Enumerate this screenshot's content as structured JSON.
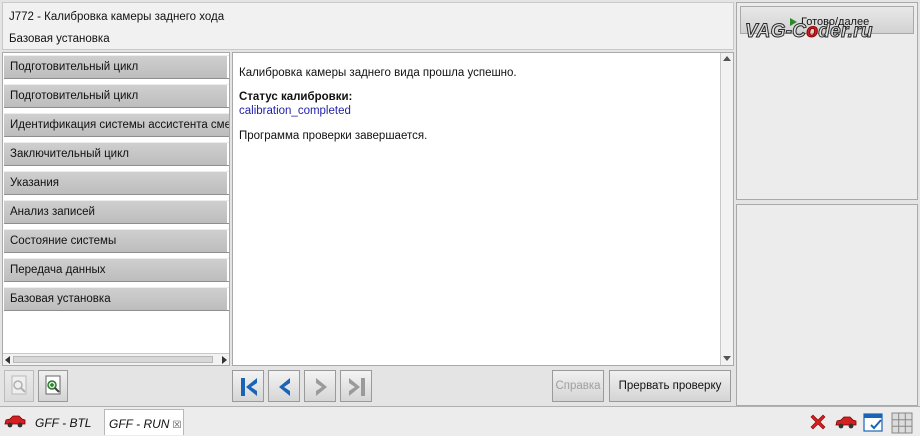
{
  "header": {
    "title": "J772 - Калибровка камеры заднего хода",
    "subtitle": "Базовая установка"
  },
  "right_panel": {
    "ready_button_label": "Готово/далее",
    "watermark_pre": "VAG-C",
    "watermark_o": "o",
    "watermark_post": "der.ru"
  },
  "sidebar": {
    "items": [
      {
        "label": "Подготовительный цикл"
      },
      {
        "label": "Подготовительный цикл"
      },
      {
        "label": "Идентификация системы ассистента смен"
      },
      {
        "label": "Заключительный цикл"
      },
      {
        "label": "Указания"
      },
      {
        "label": "Анализ записей"
      },
      {
        "label": "Состояние системы"
      },
      {
        "label": "Передача данных"
      },
      {
        "label": "Базовая установка"
      }
    ]
  },
  "content": {
    "line1": "Калибровка камеры заднего вида прошла успешно.",
    "status_label": "Статус калибровки:",
    "status_value": "calibration_completed",
    "line3": "Программа проверки завершается."
  },
  "buttons": {
    "help": "Справка",
    "abort": "Прервать проверку"
  },
  "taskbar": {
    "tabs": [
      {
        "label": "GFF - BTL"
      },
      {
        "label": "GFF - RUN"
      }
    ],
    "close_glyph": "☒"
  },
  "colors": {
    "nav_blue": "#1a64b8",
    "nav_disabled": "#9a9a9a",
    "status_value": "#1f1fa8",
    "ready_arrow": "#2a8a2a",
    "cancel_red": "#d42020"
  }
}
